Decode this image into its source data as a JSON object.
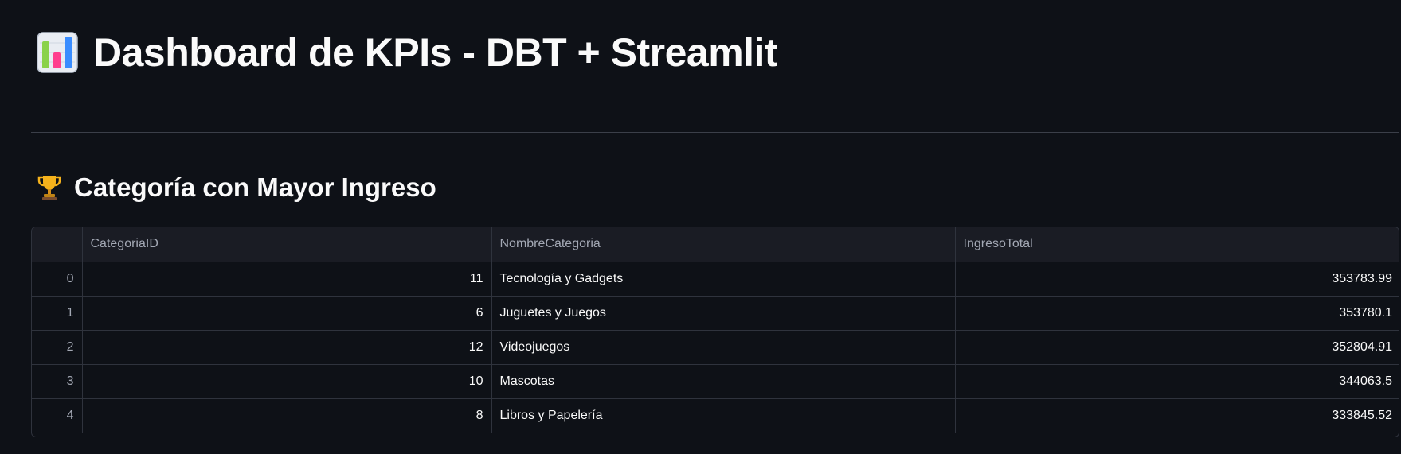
{
  "header": {
    "icon": "bar-chart-icon",
    "title": "Dashboard de KPIs - DBT + Streamlit"
  },
  "section": {
    "icon": "trophy-icon",
    "title": "Categoría con Mayor Ingreso"
  },
  "table": {
    "columns": [
      "",
      "CategoriaID",
      "NombreCategoria",
      "IngresoTotal"
    ],
    "rows": [
      {
        "index": "0",
        "CategoriaID": "11",
        "NombreCategoria": "Tecnología y Gadgets",
        "IngresoTotal": "353783.99"
      },
      {
        "index": "1",
        "CategoriaID": "6",
        "NombreCategoria": "Juguetes y Juegos",
        "IngresoTotal": "353780.1"
      },
      {
        "index": "2",
        "CategoriaID": "12",
        "NombreCategoria": "Videojuegos",
        "IngresoTotal": "352804.91"
      },
      {
        "index": "3",
        "CategoriaID": "10",
        "NombreCategoria": "Mascotas",
        "IngresoTotal": "344063.5"
      },
      {
        "index": "4",
        "CategoriaID": "8",
        "NombreCategoria": "Libros y Papelería",
        "IngresoTotal": "333845.52"
      }
    ]
  },
  "colors": {
    "background": "#0e1117",
    "text": "#fafafa",
    "muted": "#a3a8b4",
    "border": "#2f333d"
  }
}
